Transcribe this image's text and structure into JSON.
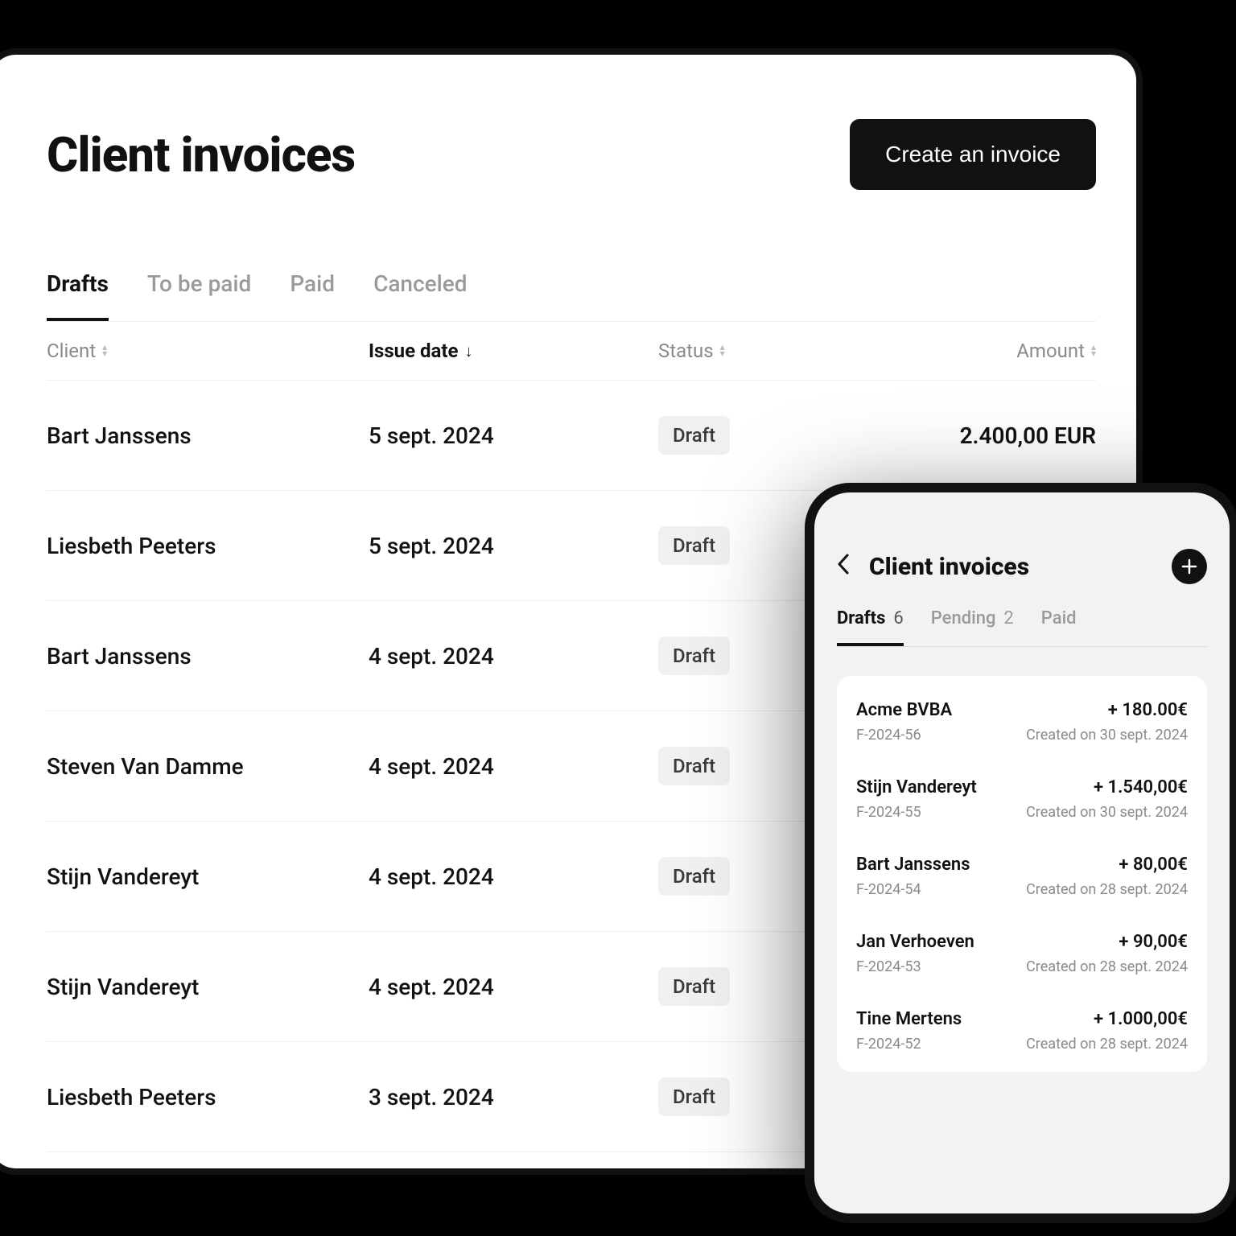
{
  "desktop": {
    "title": "Client invoices",
    "create_label": "Create an invoice",
    "tabs": [
      "Drafts",
      "To be paid",
      "Paid",
      "Canceled"
    ],
    "columns": {
      "client": "Client",
      "issue_date": "Issue date",
      "status": "Status",
      "amount": "Amount"
    },
    "rows": [
      {
        "client": "Bart Janssens",
        "date": "5 sept. 2024",
        "status": "Draft",
        "amount": "2.400,00 EUR"
      },
      {
        "client": "Liesbeth Peeters",
        "date": "5 sept. 2024",
        "status": "Draft",
        "amount": ""
      },
      {
        "client": "Bart Janssens",
        "date": "4 sept. 2024",
        "status": "Draft",
        "amount": ""
      },
      {
        "client": "Steven Van Damme",
        "date": "4 sept. 2024",
        "status": "Draft",
        "amount": ""
      },
      {
        "client": "Stijn Vandereyt",
        "date": "4 sept. 2024",
        "status": "Draft",
        "amount": ""
      },
      {
        "client": "Stijn Vandereyt",
        "date": "4 sept. 2024",
        "status": "Draft",
        "amount": ""
      },
      {
        "client": "Liesbeth Peeters",
        "date": "3 sept. 2024",
        "status": "Draft",
        "amount": ""
      }
    ]
  },
  "mobile": {
    "title": "Client invoices",
    "tabs": [
      {
        "label": "Drafts",
        "count": "6"
      },
      {
        "label": "Pending",
        "count": "2"
      },
      {
        "label": "Paid",
        "count": ""
      }
    ],
    "items": [
      {
        "client": "Acme BVBA",
        "amount": "+ 180.00€",
        "ref": "F-2024-56",
        "meta": "Created on 30 sept. 2024"
      },
      {
        "client": "Stijn Vandereyt",
        "amount": "+ 1.540,00€",
        "ref": "F-2024-55",
        "meta": "Created on 30 sept. 2024"
      },
      {
        "client": "Bart Janssens",
        "amount": "+ 80,00€",
        "ref": "F-2024-54",
        "meta": "Created on 28 sept. 2024"
      },
      {
        "client": "Jan Verhoeven",
        "amount": "+ 90,00€",
        "ref": "F-2024-53",
        "meta": "Created on 28 sept. 2024"
      },
      {
        "client": "Tine Mertens",
        "amount": "+ 1.000,00€",
        "ref": "F-2024-52",
        "meta": "Created on 28 sept. 2024"
      }
    ]
  }
}
